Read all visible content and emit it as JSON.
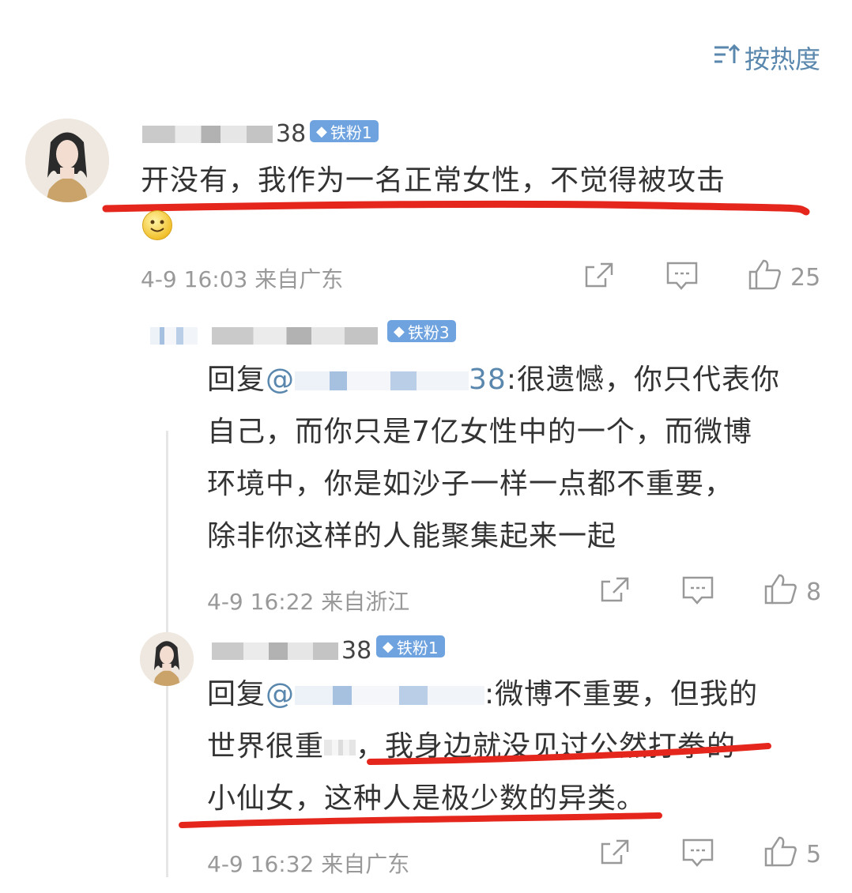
{
  "sort_label": "按热度",
  "comments": [
    {
      "username_suffix": "38",
      "badge": "铁粉1",
      "text": "开没有，我作为一名正常女性，不觉得被攻击",
      "time": "4-9 16:03",
      "location": "来自广东",
      "likes": "25"
    },
    {
      "badge": "铁粉3",
      "reply_prefix": "回复",
      "mention_prefix": "@",
      "mention_suffix": "38",
      "text_line1": ":很遗憾，你只代表你",
      "text_line2": "自己，而你只是7亿女性中的一个，而微博",
      "text_line3": "环境中，你是如沙子一样一点都不重要，",
      "text_line4": "除非你这样的人能聚集起来一起",
      "time": "4-9 16:22",
      "location": "来自浙江",
      "likes": "8"
    },
    {
      "username_suffix": "38",
      "badge": "铁粉1",
      "reply_prefix": "回复",
      "mention_prefix": "@",
      "text_line1": ":微博不重要，但我的",
      "text_line2a": "世界很重",
      "text_line2b": "，我身边就没见过公然打拳的",
      "text_line3": "小仙女，这种人是极少数的异类。",
      "time": "4-9 16:32",
      "location": "来自广东",
      "likes": "5"
    }
  ],
  "colors": {
    "accent_blue": "#5a87ad",
    "badge_blue": "#6ea3df",
    "underline_red": "#e5261c",
    "meta_gray": "#999999"
  },
  "icons": [
    "sort-icon",
    "share-icon",
    "comment-icon",
    "like-icon",
    "smile-emoji-icon",
    "diamond-icon"
  ]
}
